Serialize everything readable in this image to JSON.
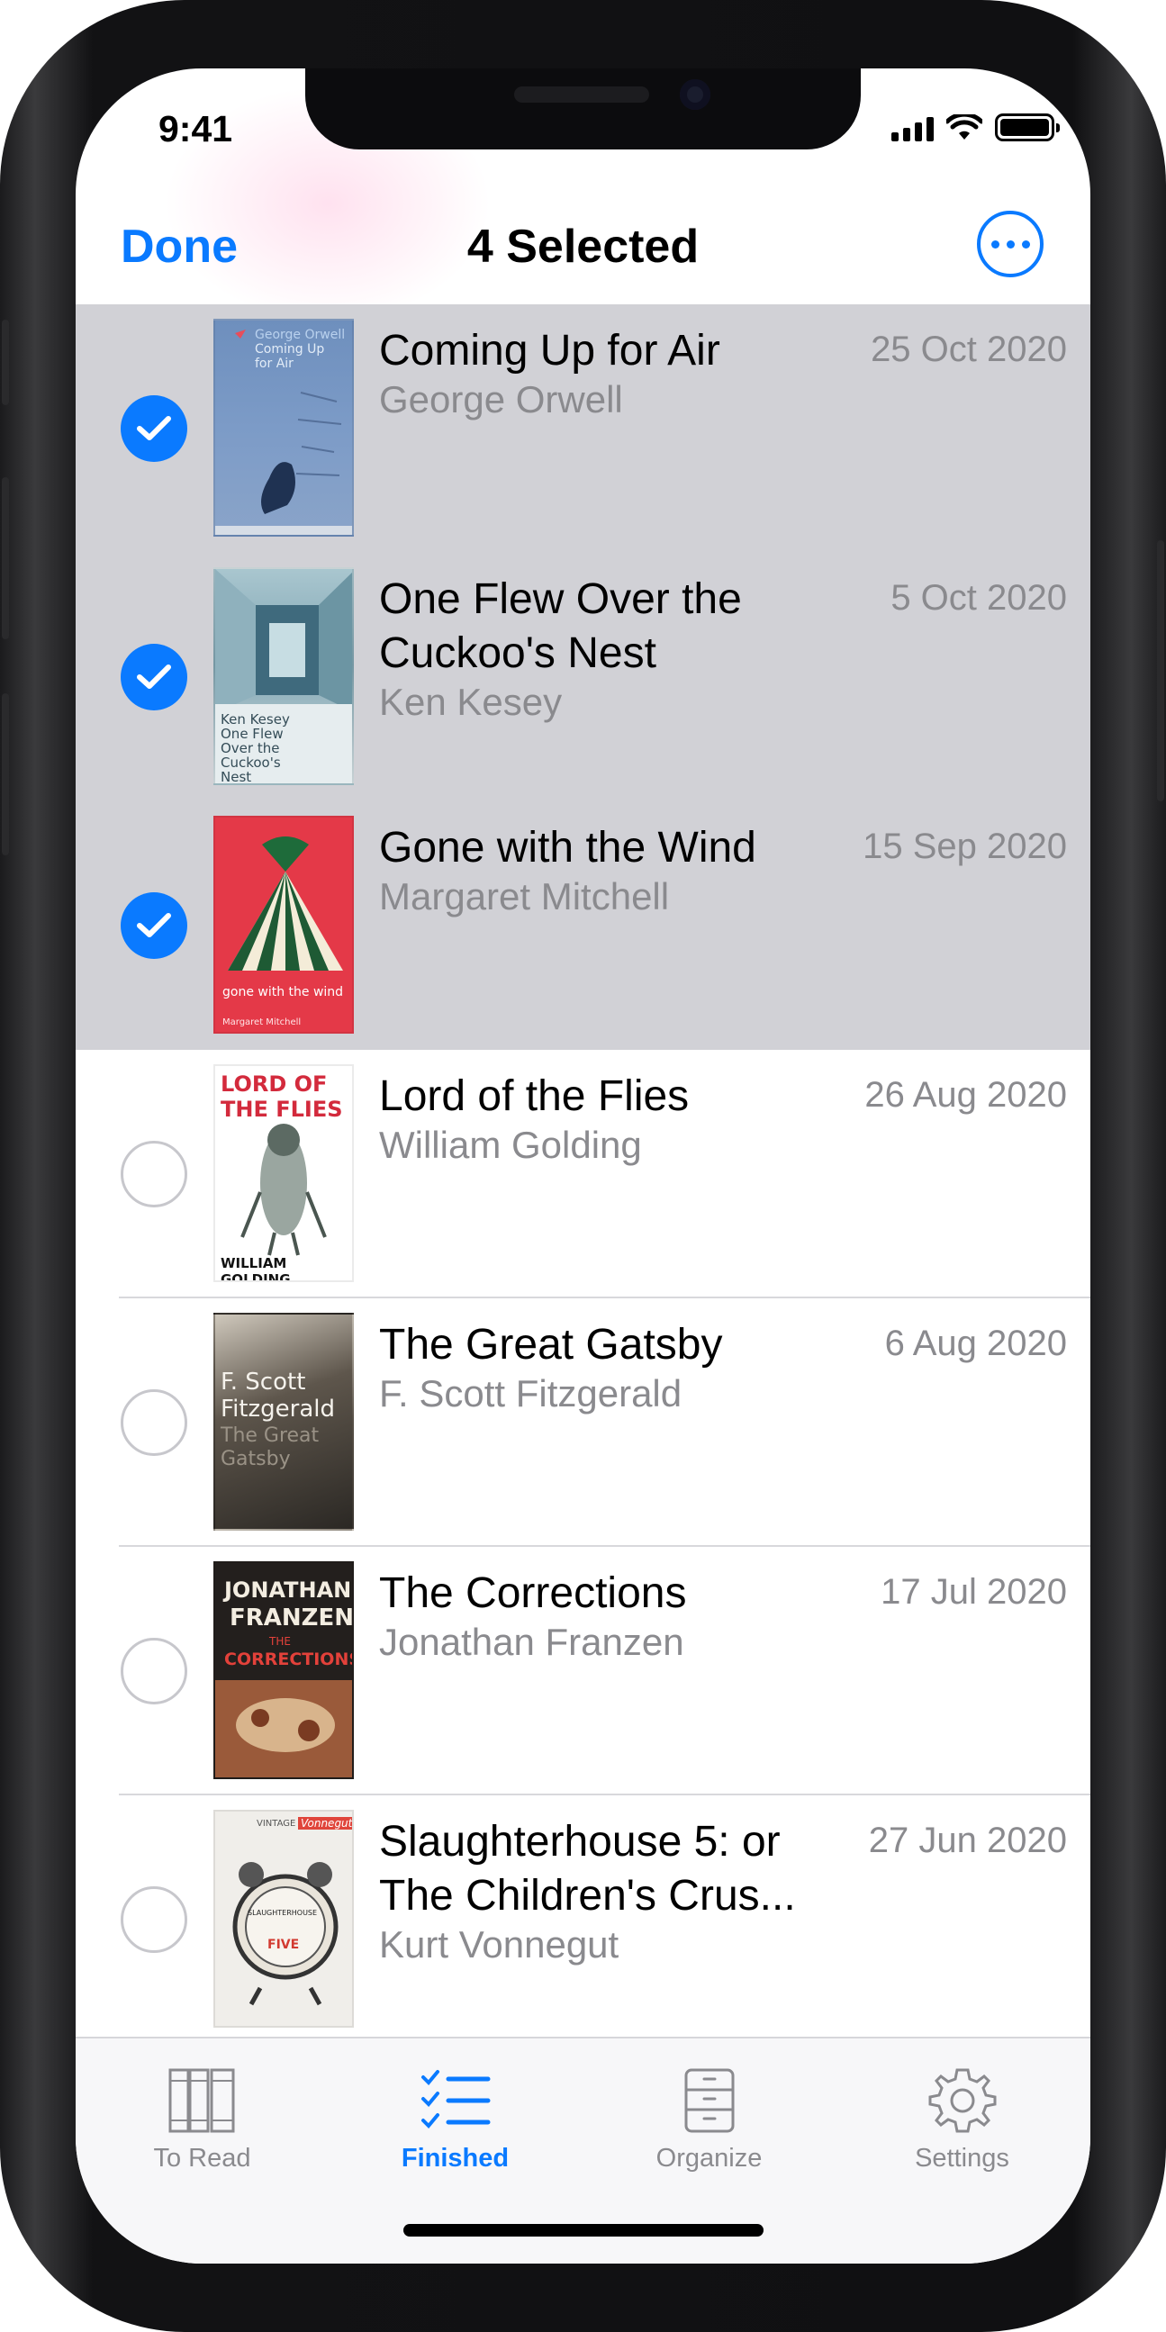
{
  "status_bar": {
    "time": "9:41",
    "signal_icon": "cellular-signal-icon",
    "wifi_icon": "wifi-icon",
    "battery_icon": "battery-icon"
  },
  "navbar": {
    "done_label": "Done",
    "title": "4 Selected",
    "more_icon": "ellipsis-circle-icon"
  },
  "books": [
    {
      "title": "Coming Up for Air",
      "author": "George Orwell",
      "date": "25 Oct 2020",
      "selected": true
    },
    {
      "title": "One Flew Over the Cuckoo's Nest",
      "author": "Ken Kesey",
      "date": "5 Oct 2020",
      "selected": true
    },
    {
      "title": "Gone with the Wind",
      "author": "Margaret Mitchell",
      "date": "15 Sep 2020",
      "selected": true
    },
    {
      "title": "Lord of the Flies",
      "author": "William Golding",
      "date": "26 Aug 2020",
      "selected": false
    },
    {
      "title": "The Great Gatsby",
      "author": "F. Scott Fitzgerald",
      "date": "6 Aug 2020",
      "selected": false
    },
    {
      "title": "The Corrections",
      "author": "Jonathan Franzen",
      "date": "17 Jul 2020",
      "selected": false
    },
    {
      "title": "Slaughterhouse 5: or The Children's Crus...",
      "author": "Kurt Vonnegut",
      "date": "27 Jun 2020",
      "selected": false
    }
  ],
  "covers": {
    "c1": {
      "line1": "George Orwell",
      "line2": "Coming Up",
      "line3": "for Air"
    },
    "c2": {
      "line1": "Ken Kesey",
      "line2": "One Flew",
      "line3": "Over the",
      "line4": "Cuckoo's",
      "line5": "Nest"
    },
    "c3": {
      "line1": "gone with the wind",
      "line2": "Margaret Mitchell"
    },
    "c4": {
      "line1": "LORD OF",
      "line2": "THE FLIES",
      "line3": "WILLIAM GOLDING"
    },
    "c5": {
      "line1": "F. Scott",
      "line2": "Fitzgerald",
      "line3": "The Great",
      "line4": "Gatsby"
    },
    "c6": {
      "line1": "JONATHAN",
      "line2": "FRANZEN",
      "line3": "THE",
      "line4": "CORRECTIONS"
    },
    "c7": {
      "line1": "VINTAGE",
      "line2": "Vonnegut",
      "line3": "SLAUGHTERHOUSE",
      "line4": "FIVE"
    }
  },
  "tabbar": {
    "tabs": [
      {
        "label": "To Read",
        "icon": "books-icon",
        "active": false
      },
      {
        "label": "Finished",
        "icon": "checklist-icon",
        "active": true
      },
      {
        "label": "Organize",
        "icon": "cabinet-icon",
        "active": false
      },
      {
        "label": "Settings",
        "icon": "gear-icon",
        "active": false
      }
    ]
  },
  "colors": {
    "accent": "#0a7aff",
    "selected_row": "#d1d1d6",
    "secondary_text": "#8a8a8e"
  }
}
